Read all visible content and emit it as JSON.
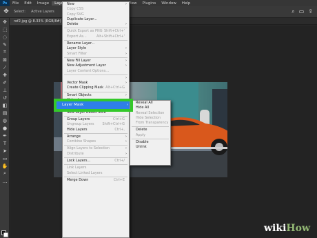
{
  "menubar": {
    "logo": "Ps",
    "items": [
      "File",
      "Edit",
      "Image",
      "Layer",
      "Type",
      "Select",
      "Filter",
      "3D",
      "View",
      "Plugins",
      "Window",
      "Help"
    ],
    "active_index": 3
  },
  "optbar": {
    "text1": "Select:",
    "text2": "Active Layers"
  },
  "tab": {
    "label": "ref2.jpg @ 8.33% (RGB/8#)"
  },
  "layer_menu": {
    "groups": [
      [
        {
          "label": "New",
          "arrow": true
        },
        {
          "label": "Copy CSS",
          "disabled": true
        },
        {
          "label": "Copy SVG",
          "disabled": true
        },
        {
          "label": "Duplicate Layer..."
        },
        {
          "label": "Delete",
          "arrow": true
        }
      ],
      [
        {
          "label": "Quick Export as PNG",
          "shortcut": "Shift+Ctrl+'",
          "disabled": true
        },
        {
          "label": "Export As...",
          "shortcut": "Alt+Shift+Ctrl+'",
          "disabled": true
        }
      ],
      [
        {
          "label": "Rename Layer..."
        },
        {
          "label": "Layer Style",
          "arrow": true
        },
        {
          "label": "Smart Filter",
          "arrow": true,
          "disabled": true
        }
      ],
      [
        {
          "label": "New Fill Layer",
          "arrow": true
        },
        {
          "label": "New Adjustment Layer",
          "arrow": true
        },
        {
          "label": "Layer Content Options...",
          "disabled": true
        }
      ],
      [
        {
          "label": "Layer Mask",
          "arrow": true,
          "highlighted": true
        },
        {
          "label": "Vector Mask",
          "arrow": true
        },
        {
          "label": "Create Clipping Mask",
          "shortcut": "Alt+Ctrl+G"
        }
      ],
      [
        {
          "label": "Smart Objects",
          "arrow": true
        },
        {
          "label": "Video Layers",
          "arrow": true
        },
        {
          "label": "Rasterize",
          "arrow": true,
          "disabled": true
        }
      ],
      [
        {
          "label": "New Layer Based Slice"
        }
      ],
      [
        {
          "label": "Group Layers",
          "shortcut": "Ctrl+G"
        },
        {
          "label": "Ungroup Layers",
          "shortcut": "Shift+Ctrl+G",
          "disabled": true
        },
        {
          "label": "Hide Layers",
          "shortcut": "Ctrl+,"
        }
      ],
      [
        {
          "label": "Arrange",
          "arrow": true
        },
        {
          "label": "Combine Shapes",
          "arrow": true,
          "disabled": true
        }
      ],
      [
        {
          "label": "Align Layers to Selection",
          "arrow": true,
          "disabled": true
        },
        {
          "label": "Distribute",
          "arrow": true,
          "disabled": true
        }
      ],
      [
        {
          "label": "Lock Layers...",
          "shortcut": "Ctrl+/"
        }
      ],
      [
        {
          "label": "Link Layers",
          "disabled": true
        },
        {
          "label": "Select Linked Layers",
          "disabled": true
        }
      ],
      [
        {
          "label": "Merge Down",
          "shortcut": "Ctrl+E"
        }
      ]
    ]
  },
  "submenu": {
    "groups": [
      [
        {
          "label": "Reveal All"
        },
        {
          "label": "Hide All"
        },
        {
          "label": "Reveal Selection",
          "disabled": true
        },
        {
          "label": "Hide Selection",
          "disabled": true
        },
        {
          "label": "From Transparency",
          "disabled": true
        }
      ],
      [
        {
          "label": "Delete"
        },
        {
          "label": "Apply",
          "disabled": true
        }
      ],
      [
        {
          "label": "Disable"
        },
        {
          "label": "Unlink"
        }
      ]
    ]
  },
  "highlight": {
    "label": "Layer Mask",
    "ring_color": "#34c82a",
    "fill_color": "#2e7fe8"
  },
  "watermark": {
    "part1": "wiki",
    "part2": "How"
  },
  "colors": {
    "car": "#d9581c",
    "menu_bg": "#f0f0f0"
  }
}
